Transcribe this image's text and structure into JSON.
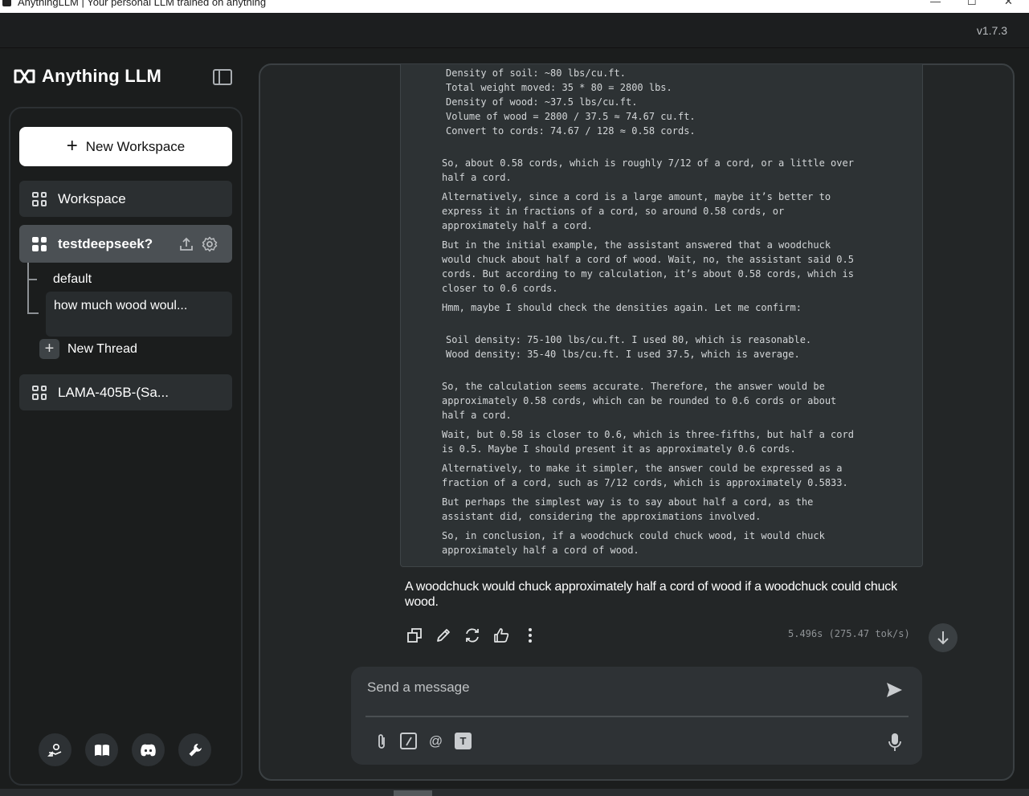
{
  "window": {
    "title": "AnythingLLM | Your personal LLM trained on anything",
    "minimize": "—",
    "maximize": "☐",
    "close": "✕"
  },
  "app": {
    "version": "v1.7.3",
    "brand": "Anything LLM"
  },
  "sidebar": {
    "new_workspace": "New Workspace",
    "workspaces": [
      {
        "label": "Workspace"
      },
      {
        "label": "testdeepseek?"
      },
      {
        "label": "LAMA-405B-(Sa..."
      }
    ],
    "threads": [
      {
        "label": "default"
      },
      {
        "label": "how much wood woul..."
      }
    ],
    "new_thread": "New Thread"
  },
  "chat": {
    "thinking_lines": [
      {
        "text": "Density of soil: ~80 lbs/cu.ft.",
        "indent": true
      },
      {
        "text": "Total weight moved: 35 * 80 = 2800 lbs.",
        "indent": true
      },
      {
        "text": "Density of wood: ~37.5 lbs/cu.ft.",
        "indent": true
      },
      {
        "text": "Volume of wood = 2800 / 37.5 ≈ 74.67 cu.ft.",
        "indent": true
      },
      {
        "text": "Convert to cords: 74.67 / 128 ≈ 0.58 cords.",
        "indent": true
      },
      {
        "text": "So, about 0.58 cords, which is roughly 7/12 of a cord, or a little over"
      },
      {
        "text": "half a cord."
      },
      {
        "text": "Alternatively, since a cord is a large amount, maybe it’s better to"
      },
      {
        "text": "express it in fractions of a cord, so around 0.58 cords, or"
      },
      {
        "text": "approximately half a cord."
      },
      {
        "text": "But in the initial example, the assistant answered that a woodchuck"
      },
      {
        "text": "would chuck about half a cord of wood. Wait, no, the assistant said 0.5"
      },
      {
        "text": "cords. But according to my calculation, it’s about 0.58 cords, which is"
      },
      {
        "text": "closer to 0.6 cords."
      },
      {
        "text": "Hmm, maybe I should check the densities again. Let me confirm:"
      },
      {
        "text": "Soil density: 75-100 lbs/cu.ft. I used 80, which is reasonable.",
        "indent": true
      },
      {
        "text": "Wood density: 35-40 lbs/cu.ft. I used 37.5, which is average.",
        "indent": true
      },
      {
        "text": "So, the calculation seems accurate. Therefore, the answer would be"
      },
      {
        "text": "approximately 0.58 cords, which can be rounded to 0.6 cords or about"
      },
      {
        "text": "half a cord."
      },
      {
        "text": "Wait, but 0.58 is closer to 0.6, which is three-fifths, but half a cord"
      },
      {
        "text": "is 0.5. Maybe I should present it as approximately 0.6 cords."
      },
      {
        "text": "Alternatively, to make it simpler, the answer could be expressed as a"
      },
      {
        "text": "fraction of a cord, such as 7/12 cords, which is approximately 0.5833."
      },
      {
        "text": "But perhaps the simplest way is to say about half a cord, as the"
      },
      {
        "text": "assistant did, considering the approximations involved."
      },
      {
        "text": "So, in conclusion, if a woodchuck could chuck wood, it would chuck"
      },
      {
        "text": "approximately half a cord of wood."
      }
    ],
    "answer": "A woodchuck would chuck approximately half a cord of wood if a woodchuck could chuck wood.",
    "timing": "5.496s (275.47 tok/s)"
  },
  "composer": {
    "placeholder": "Send a message"
  },
  "icons": {
    "copy": "copy-icon",
    "edit": "pencil-icon",
    "regenerate": "refresh-icon",
    "like": "thumbs-up-icon",
    "more": "more-vertical-icon",
    "scroll_down": "arrow-down-icon",
    "send": "send-icon",
    "attach": "paperclip-icon",
    "slash": "slash-command-icon",
    "mention": "at-icon",
    "text_size": "text-format-icon",
    "mic": "microphone-icon"
  }
}
